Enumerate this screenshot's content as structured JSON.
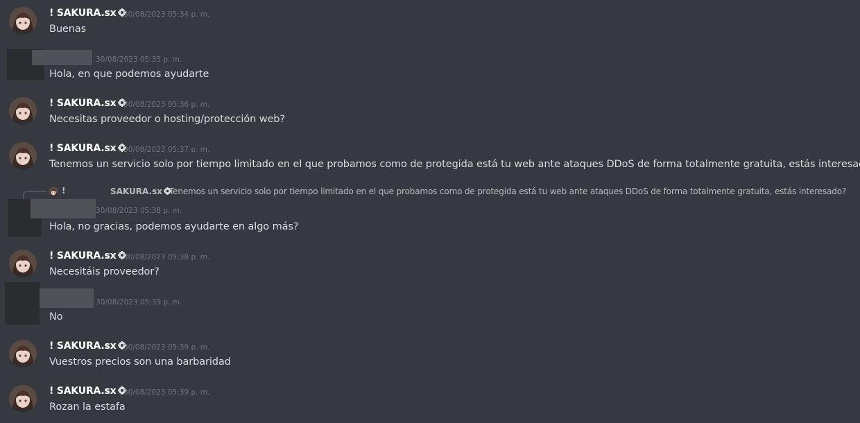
{
  "user": {
    "name": "! SAKURA.sx",
    "reply_prefix": "!",
    "reply_name": "SAKURA.sx",
    "badge_icon": "gear-badge-icon"
  },
  "messages": [
    {
      "author": "sakura",
      "time": "30/08/2023 05:34 p. m.",
      "text": "Buenas"
    },
    {
      "author": "redacted",
      "time": "30/08/2023 05:35 p. m.",
      "text": "Hola, en que podemos ayudarte"
    },
    {
      "author": "sakura",
      "time": "30/08/2023 05:36 p. m.",
      "text": "Necesitas proveedor o hosting/protección web?"
    },
    {
      "author": "sakura",
      "time": "30/08/2023 05:37 p. m.",
      "text": "Tenemos un servicio solo por tiempo limitado en el que probamos como de protegida está tu web ante ataques DDoS de forma totalmente gratuita, estás interesado?"
    },
    {
      "author": "redacted",
      "time": "30/08/2023 05:38 p. m.",
      "text": "Hola, no gracias, podemos ayudarte en algo más?"
    },
    {
      "author": "sakura",
      "time": "30/08/2023 05:38 p. m.",
      "text": "Necesitáis proveedor?"
    },
    {
      "author": "redacted",
      "time": "30/08/2023 05:39 p. m.",
      "text": "No"
    },
    {
      "author": "sakura",
      "time": "30/08/2023 05:39 p. m.",
      "text": "Vuestros precios son una barbaridad"
    },
    {
      "author": "sakura",
      "time": "30/08/2023 05:39 p. m.",
      "text": "Rozan la estafa"
    }
  ],
  "reply": {
    "text": "Tenemos un servicio solo por tiempo limitado en el que probamos como de protegida está tu web ante ataques DDoS de forma totalmente gratuita, estás interesado?"
  },
  "colors": {
    "background": "#36393f",
    "username": "#ffffff",
    "timestamp": "#72767d",
    "message_text": "#dcddde",
    "redaction": "#2a2c30"
  }
}
